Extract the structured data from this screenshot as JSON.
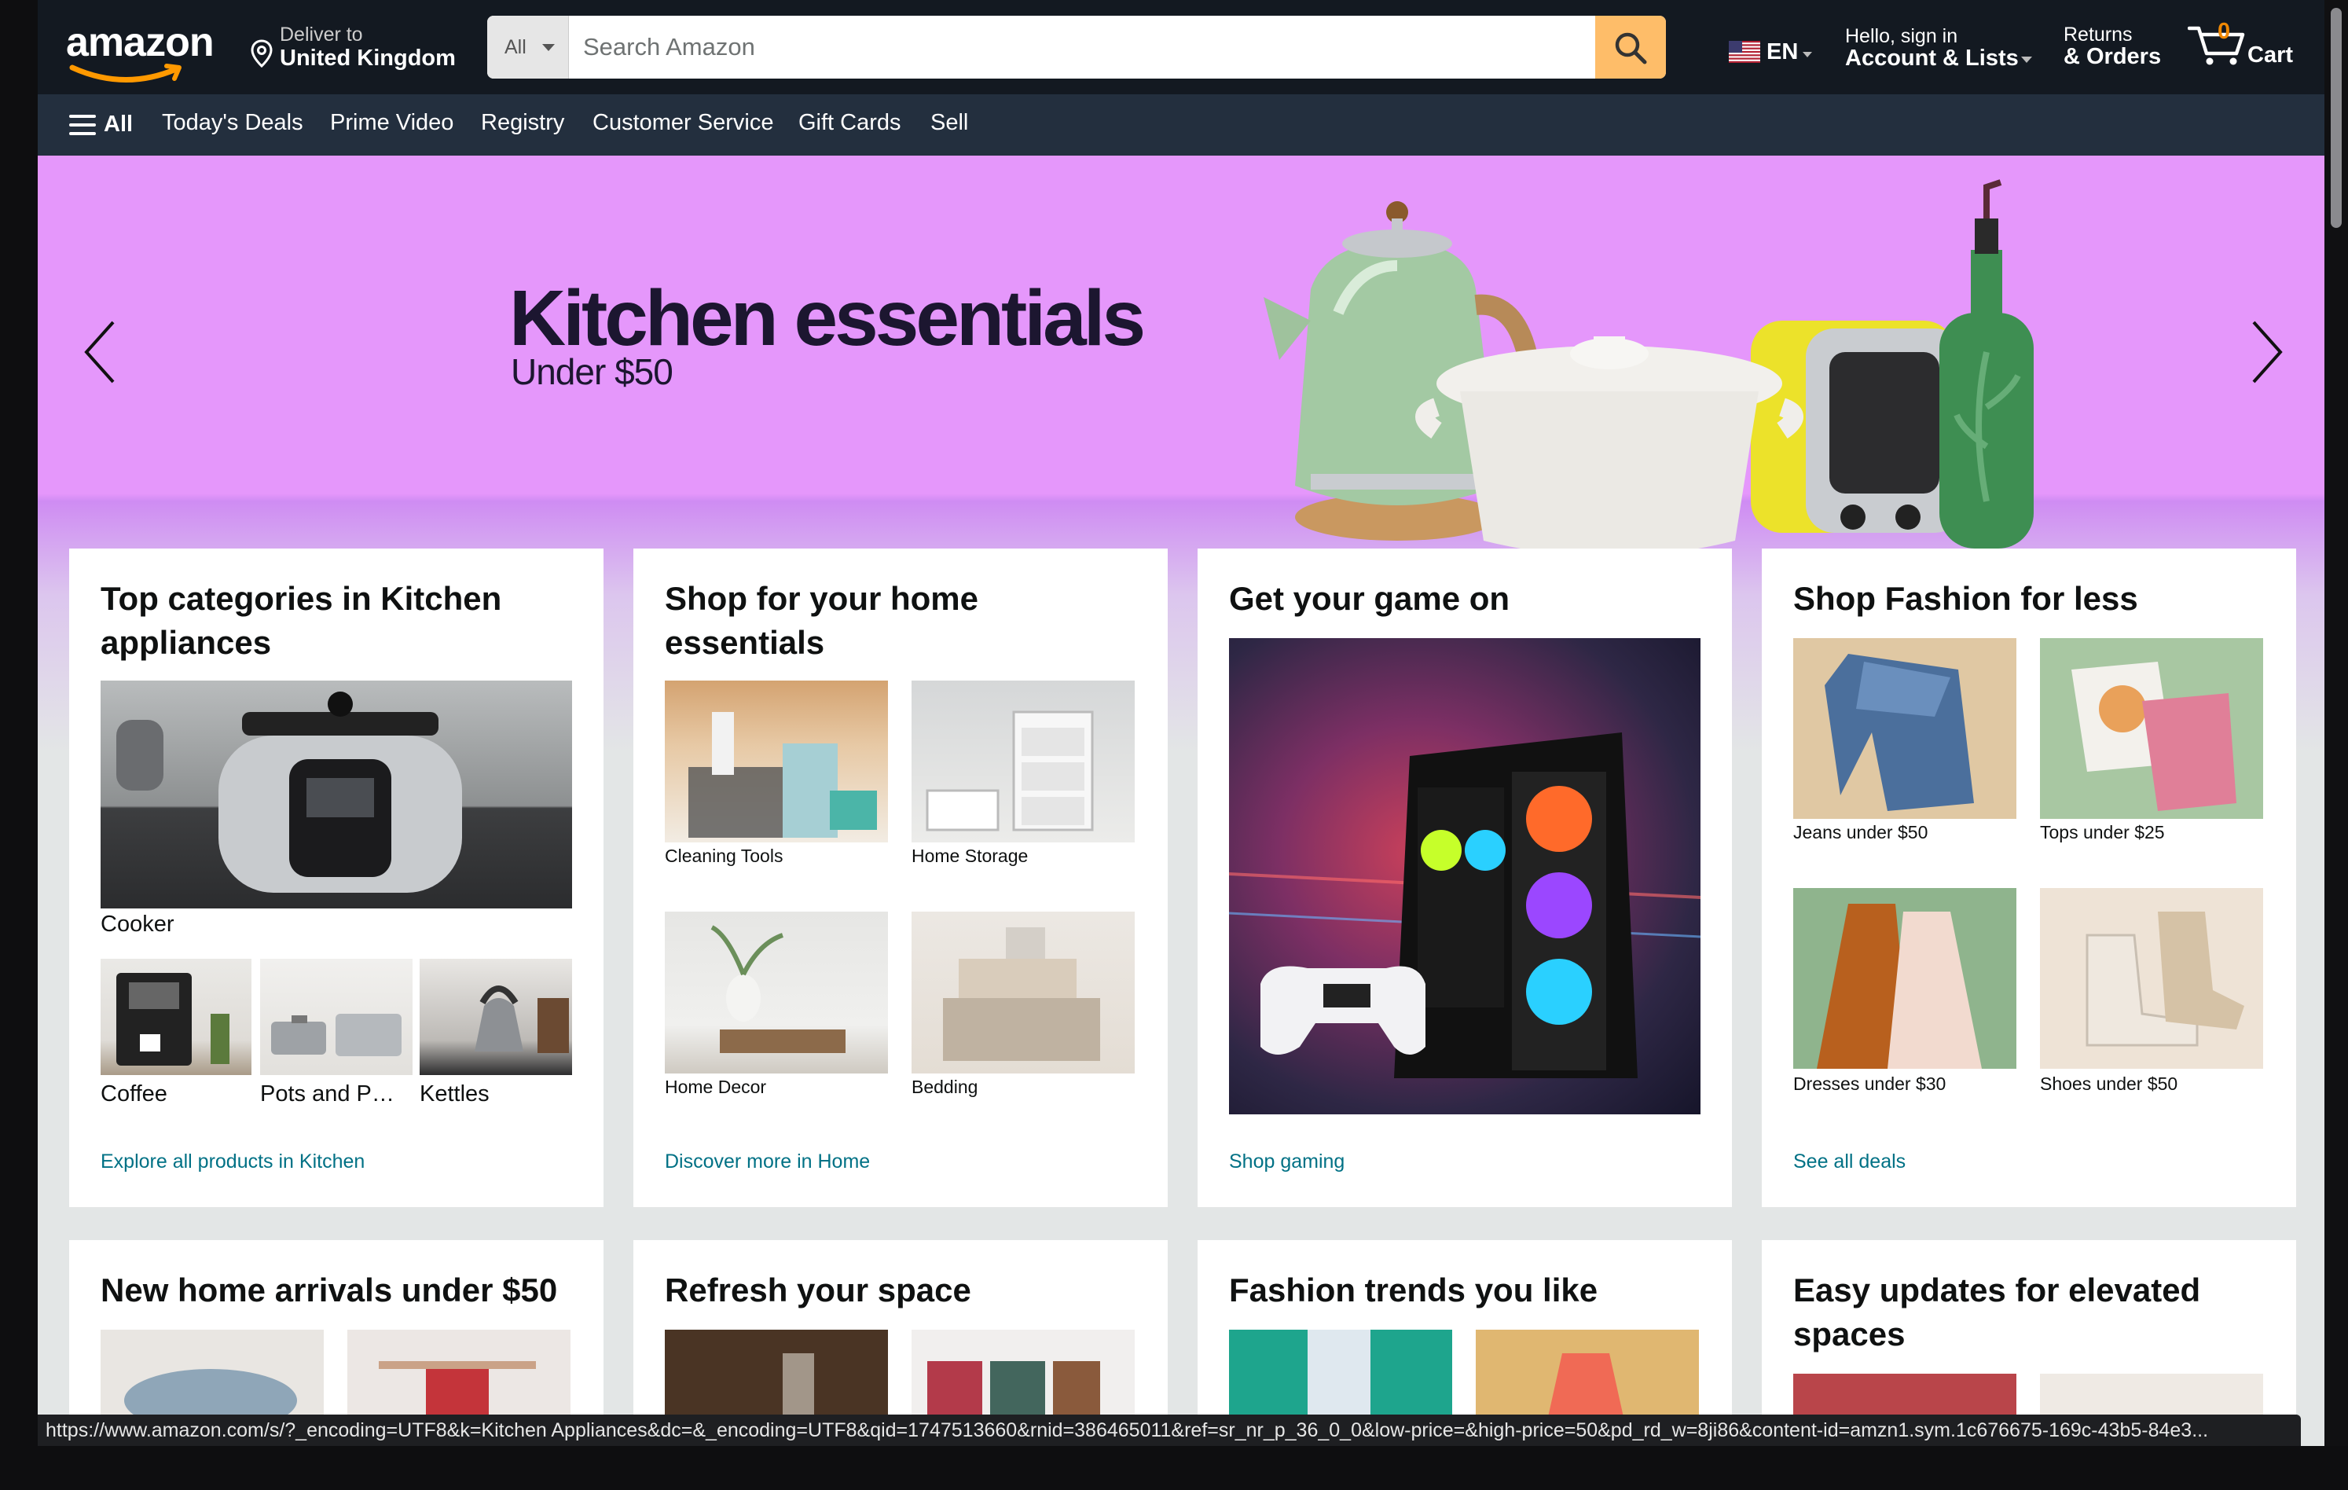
{
  "header": {
    "logo_text": "amazon",
    "deliver_line1": "Deliver to",
    "deliver_line2": "United Kingdom",
    "search_category": "All",
    "search_placeholder": "Search Amazon",
    "language": "EN",
    "account_line1": "Hello, sign in",
    "account_line2": "Account & Lists",
    "returns_line1": "Returns",
    "returns_line2": "& Orders",
    "cart_count": "0",
    "cart_label": "Cart"
  },
  "subnav": {
    "all_label": "All",
    "links": [
      "Today's Deals",
      "Prime Video",
      "Registry",
      "Customer Service",
      "Gift Cards",
      "Sell"
    ]
  },
  "hero": {
    "title": "Kitchen essentials",
    "subtitle": "Under $50"
  },
  "cards": [
    {
      "title": "Top categories in Kitchen appliances",
      "main_caption": "Cooker",
      "items": [
        "Coffee",
        "Pots and P…",
        "Kettles"
      ],
      "link": "Explore all products in Kitchen"
    },
    {
      "title": "Shop for your home essentials",
      "items": [
        "Cleaning Tools",
        "Home Storage",
        "Home Decor",
        "Bedding"
      ],
      "link": "Discover more in Home"
    },
    {
      "title": "Get your game on",
      "link": "Shop gaming"
    },
    {
      "title": "Shop Fashion for less",
      "items": [
        "Jeans under $50",
        "Tops under $25",
        "Dresses under $30",
        "Shoes under $50"
      ],
      "link": "See all deals"
    }
  ],
  "cards_row2": [
    {
      "title": "New home arrivals under $50"
    },
    {
      "title": "Refresh your space"
    },
    {
      "title": "Fashion trends you like"
    },
    {
      "title": "Easy updates for elevated spaces"
    }
  ],
  "status_url": "https://www.amazon.com/s/?_encoding=UTF8&k=Kitchen Appliances&dc=&_encoding=UTF8&qid=1747513660&rnid=386465011&ref=sr_nr_p_36_0_0&low-price=&high-price=50&pd_rd_w=8ji86&content-id=amzn1.sym.1c676675-169c-43b5-84e3...",
  "colors": {
    "nav_bg": "#131921",
    "subnav_bg": "#232f3e",
    "search_button": "#febd69",
    "link": "#007185",
    "hero_bg": "#e597fb",
    "logo_smile": "#ff9900",
    "cart_count": "#f08804"
  },
  "icons": {
    "location": "location-pin-icon",
    "search": "magnifier-icon",
    "cart": "cart-icon",
    "menu": "hamburger-menu-icon",
    "flag": "us-flag-icon",
    "prev": "chevron-left-icon",
    "next": "chevron-right-icon"
  }
}
